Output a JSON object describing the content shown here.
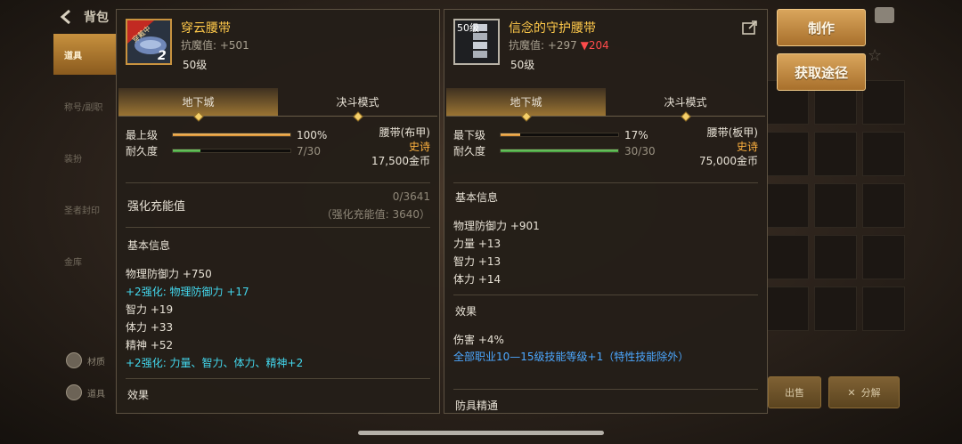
{
  "topbar": {
    "title": "背包"
  },
  "sidebar": {
    "items": [
      {
        "label": "道具",
        "active": true
      },
      {
        "label": "称号/副职",
        "active": false
      },
      {
        "label": "装扮",
        "active": false
      },
      {
        "label": "圣者封印",
        "active": false
      },
      {
        "label": "金库",
        "active": false
      }
    ],
    "bottom": [
      {
        "label": "材质"
      },
      {
        "label": "道具"
      }
    ]
  },
  "left_panel": {
    "badge_tag": "穿戴中",
    "badge_num": "2",
    "name": "穿云腰带",
    "resist_label": "抗魔值: +501",
    "level": "50级",
    "tabs": [
      "地下城",
      "决斗模式"
    ],
    "stats": {
      "top_label": "最上级",
      "top_pct": "100%",
      "top_fill": 1.0,
      "dur_label": "耐久度",
      "dur_value": "7/30",
      "dur_fill": 0.233,
      "type": "腰带(布甲)",
      "rarity": "史诗",
      "price": "17,500金币"
    },
    "energy": {
      "title": "强化充能值",
      "value": "0/3641",
      "sub": "（强化充能值: 3640）"
    },
    "basic_title": "基本信息",
    "basic_lines": [
      {
        "text": "物理防御力 +750",
        "style": "normal"
      },
      {
        "text": "+2强化: 物理防御力 +17",
        "style": "cyan"
      },
      {
        "text": "智力 +19",
        "style": "normal"
      },
      {
        "text": "体力 +33",
        "style": "normal"
      },
      {
        "text": "精神 +52",
        "style": "normal"
      },
      {
        "text": "+2强化: 力量、智力、体力、精神+2",
        "style": "cyan"
      }
    ],
    "effect_title": "效果"
  },
  "right_panel": {
    "badge_level": "50级",
    "name": "信念的守护腰带",
    "resist_label": "抗魔值: +297",
    "resist_delta": "▼204",
    "level": "50级",
    "tabs": [
      "地下城",
      "决斗模式"
    ],
    "stats": {
      "top_label": "最下级",
      "top_pct": "17%",
      "top_fill": 0.17,
      "dur_label": "耐久度",
      "dur_value": "30/30",
      "dur_fill": 1.0,
      "type": "腰带(板甲)",
      "rarity": "史诗",
      "price": "75,000金币"
    },
    "basic_title": "基本信息",
    "basic_lines": [
      {
        "text": "物理防御力 +901",
        "style": "normal"
      },
      {
        "text": "力量 +13",
        "style": "normal"
      },
      {
        "text": "智力 +13",
        "style": "normal"
      },
      {
        "text": "体力 +14",
        "style": "normal"
      }
    ],
    "effect_title": "效果",
    "effect_lines": [
      {
        "text": "伤害 +4%",
        "style": "normal"
      },
      {
        "text": "全部职业10—15级技能等级+1（特性技能除外）",
        "style": "blue"
      }
    ],
    "extra_title": "防具精通"
  },
  "actions": {
    "craft_label": "制作",
    "source_label": "获取途径",
    "sell_label": "出售",
    "disassemble_label": "分解"
  },
  "colors": {
    "gold_text": "#ffc94a",
    "epic": "#ffb23f",
    "enhance_cyan": "#43d8ee",
    "effect_blue": "#4ca8ff",
    "decrease_red": "#ff4b4b",
    "button_gold": "#c98d3e"
  }
}
